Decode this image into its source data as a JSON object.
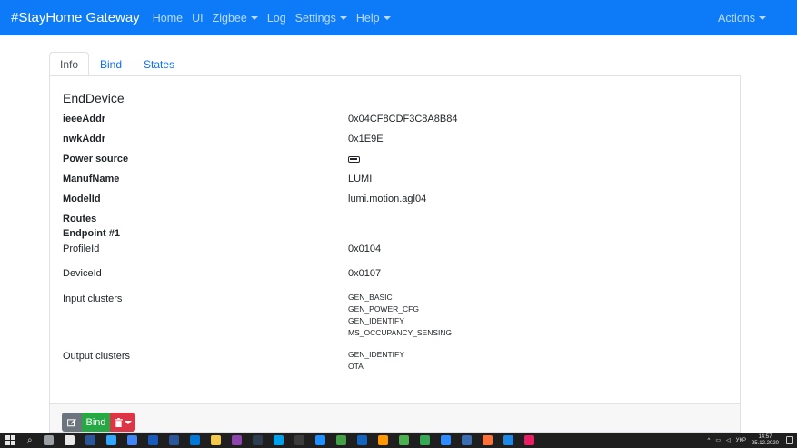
{
  "navbar": {
    "brand": "#StayHome Gateway",
    "items": [
      {
        "label": "Home",
        "dropdown": false
      },
      {
        "label": "UI",
        "dropdown": false
      },
      {
        "label": "Zigbee",
        "dropdown": true
      },
      {
        "label": "Log",
        "dropdown": false
      },
      {
        "label": "Settings",
        "dropdown": true
      },
      {
        "label": "Help",
        "dropdown": true
      }
    ],
    "actions_label": "Actions"
  },
  "tabs": [
    {
      "label": "Info",
      "active": true
    },
    {
      "label": "Bind",
      "active": false
    },
    {
      "label": "States",
      "active": false
    }
  ],
  "device": {
    "type": "EndDevice",
    "fields": {
      "ieeeAddr": {
        "label": "ieeeAddr",
        "value": "0x04CF8CDF3C8A8B84"
      },
      "nwkAddr": {
        "label": "nwkAddr",
        "value": "0x1E9E"
      },
      "powerSource": {
        "label": "Power source",
        "icon": "battery-icon"
      },
      "manufName": {
        "label": "ManufName",
        "value": "LUMI"
      },
      "modelId": {
        "label": "ModelId",
        "value": "lumi.motion.agl04"
      }
    },
    "routes_label": "Routes",
    "endpoint": {
      "label": "Endpoint #1",
      "profileId": {
        "label": "ProfileId",
        "value": "0x0104"
      },
      "deviceId": {
        "label": "DeviceId",
        "value": "0x0107"
      },
      "input_clusters_label": "Input clusters",
      "input_clusters": [
        "GEN_BASIC",
        "GEN_POWER_CFG",
        "GEN_IDENTIFY",
        "MS_OCCUPANCY_SENSING"
      ],
      "output_clusters_label": "Output clusters",
      "output_clusters": [
        "GEN_IDENTIFY",
        "OTA"
      ]
    }
  },
  "buttons": {
    "edit_icon": "pencil-square-icon",
    "bind_label": "Bind",
    "delete_icon": "trash-icon"
  },
  "taskbar": {
    "lang": "УКР",
    "time": "14:57",
    "date": "25.12.2020",
    "icon_colors": [
      "#9aa0a6",
      "#e8e8e8",
      "#2b579a",
      "#31a8ff",
      "#4285f4",
      "#185abd",
      "#2b579a",
      "#0078d7",
      "#f2c94c",
      "#8e44ad",
      "#2c3e50",
      "#00a2ed",
      "#3c3c3c",
      "#1e90ff",
      "#43a047",
      "#1565c0",
      "#ff9800",
      "#4caf50",
      "#34a853",
      "#2d8cff",
      "#3c6eb4",
      "#ff7139",
      "#1e88e5",
      "#e91e63"
    ]
  }
}
